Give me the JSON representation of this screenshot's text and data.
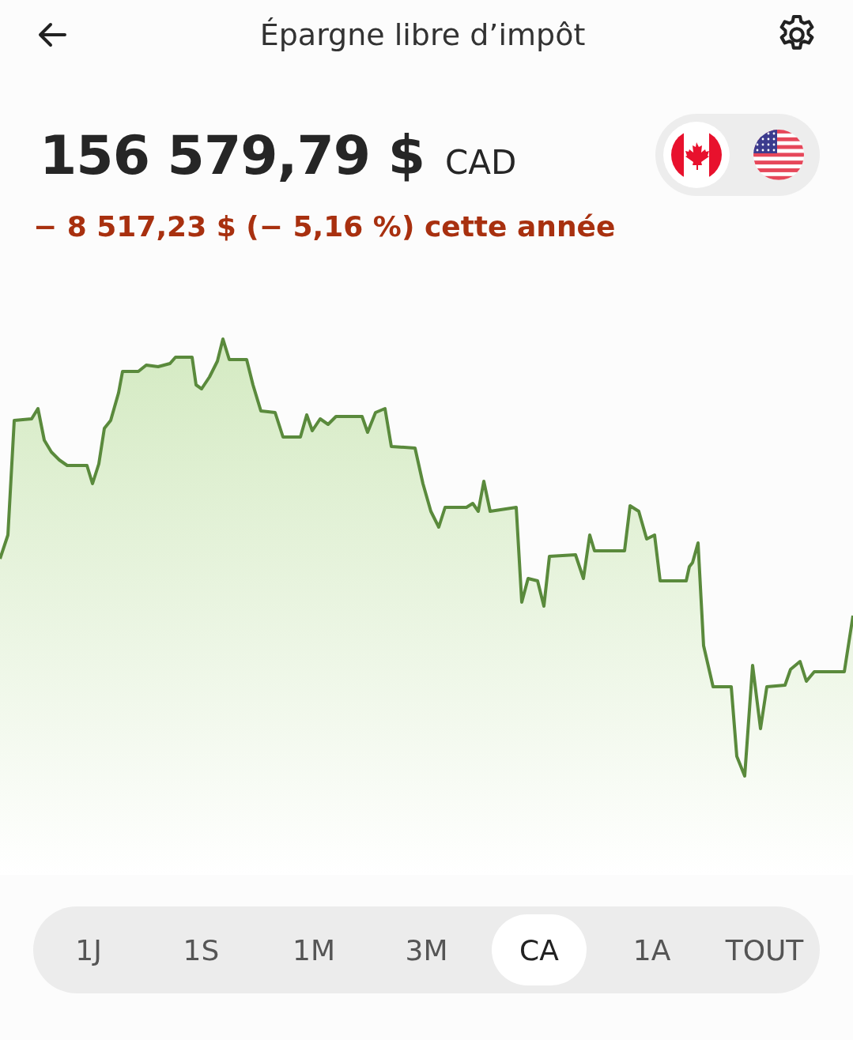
{
  "header": {
    "title": "Épargne libre d’impôt"
  },
  "balance": {
    "amount": "156 579,79 $",
    "currency": "CAD"
  },
  "currency_toggle": [
    {
      "kind": "canada",
      "selected": true
    },
    {
      "kind": "us",
      "selected": false
    }
  ],
  "change": {
    "text": "− 8 517,23 $ (− 5,16 %) cette année",
    "negative": true
  },
  "ranges": [
    {
      "label": "1J",
      "selected": false
    },
    {
      "label": "1S",
      "selected": false
    },
    {
      "label": "1M",
      "selected": false
    },
    {
      "label": "3M",
      "selected": false
    },
    {
      "label": "CA",
      "selected": true
    },
    {
      "label": "1A",
      "selected": false
    },
    {
      "label": "TOUT",
      "selected": false
    }
  ]
}
